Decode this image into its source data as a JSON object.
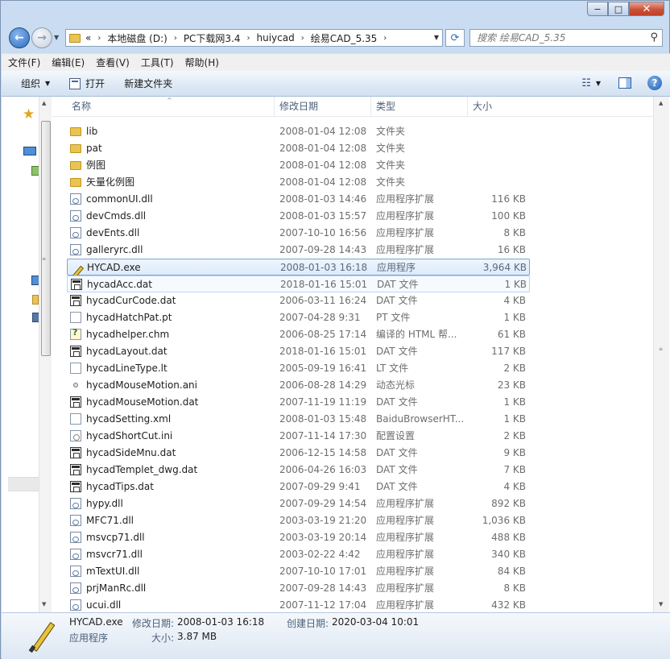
{
  "window": {
    "minimize": "−",
    "maximize": "□",
    "close": "✕"
  },
  "address": {
    "overflow": "«",
    "crumbs": [
      "本地磁盘 (D:)",
      "PC下载网3.4",
      "huiycad",
      "绘易CAD_5.35"
    ]
  },
  "search": {
    "placeholder": "搜索 绘易CAD_5.35"
  },
  "menu": [
    "文件(F)",
    "编辑(E)",
    "查看(V)",
    "工具(T)",
    "帮助(H)"
  ],
  "toolbar": {
    "organize": "组织",
    "open": "打开",
    "new_folder": "新建文件夹"
  },
  "columns": {
    "name": "名称",
    "date": "修改日期",
    "type": "类型",
    "size": "大小"
  },
  "files": [
    {
      "name": "lib",
      "date": "2008-01-04 12:08",
      "type": "文件夹",
      "size": "",
      "icon": "folder"
    },
    {
      "name": "pat",
      "date": "2008-01-04 12:08",
      "type": "文件夹",
      "size": "",
      "icon": "folder"
    },
    {
      "name": "例图",
      "date": "2008-01-04 12:08",
      "type": "文件夹",
      "size": "",
      "icon": "folder"
    },
    {
      "name": "矢量化例图",
      "date": "2008-01-04 12:08",
      "type": "文件夹",
      "size": "",
      "icon": "folder"
    },
    {
      "name": "commonUI.dll",
      "date": "2008-01-03 14:46",
      "type": "应用程序扩展",
      "size": "116 KB",
      "icon": "dll"
    },
    {
      "name": "devCmds.dll",
      "date": "2008-01-03 15:57",
      "type": "应用程序扩展",
      "size": "100 KB",
      "icon": "dll"
    },
    {
      "name": "devEnts.dll",
      "date": "2007-10-10 16:56",
      "type": "应用程序扩展",
      "size": "8 KB",
      "icon": "dll"
    },
    {
      "name": "galleryrc.dll",
      "date": "2007-09-28 14:43",
      "type": "应用程序扩展",
      "size": "16 KB",
      "icon": "dll"
    },
    {
      "name": "HYCAD.exe",
      "date": "2008-01-03 16:18",
      "type": "应用程序",
      "size": "3,964 KB",
      "icon": "exe",
      "state": "selected"
    },
    {
      "name": "hycadAcc.dat",
      "date": "2018-01-16 15:01",
      "type": "DAT 文件",
      "size": "1 KB",
      "icon": "dat",
      "state": "hover"
    },
    {
      "name": "hycadCurCode.dat",
      "date": "2006-03-11 16:24",
      "type": "DAT 文件",
      "size": "4 KB",
      "icon": "dat"
    },
    {
      "name": "hycadHatchPat.pt",
      "date": "2007-04-28 9:31",
      "type": "PT 文件",
      "size": "1 KB",
      "icon": "plain"
    },
    {
      "name": "hycadhelper.chm",
      "date": "2006-08-25 17:14",
      "type": "编译的 HTML 帮...",
      "size": "61 KB",
      "icon": "chm"
    },
    {
      "name": "hycadLayout.dat",
      "date": "2018-01-16 15:01",
      "type": "DAT 文件",
      "size": "117 KB",
      "icon": "dat"
    },
    {
      "name": "hycadLineType.lt",
      "date": "2005-09-19 16:41",
      "type": "LT 文件",
      "size": "2 KB",
      "icon": "plain"
    },
    {
      "name": "hycadMouseMotion.ani",
      "date": "2006-08-28 14:29",
      "type": "动态光标",
      "size": "23 KB",
      "icon": "ani"
    },
    {
      "name": "hycadMouseMotion.dat",
      "date": "2007-11-19 11:19",
      "type": "DAT 文件",
      "size": "1 KB",
      "icon": "dat"
    },
    {
      "name": "hycadSetting.xml",
      "date": "2008-01-03 15:48",
      "type": "BaiduBrowserHT...",
      "size": "1 KB",
      "icon": "plain"
    },
    {
      "name": "hycadShortCut.ini",
      "date": "2007-11-14 17:30",
      "type": "配置设置",
      "size": "2 KB",
      "icon": "ini"
    },
    {
      "name": "hycadSideMnu.dat",
      "date": "2006-12-15 14:58",
      "type": "DAT 文件",
      "size": "9 KB",
      "icon": "dat"
    },
    {
      "name": "hycadTemplet_dwg.dat",
      "date": "2006-04-26 16:03",
      "type": "DAT 文件",
      "size": "7 KB",
      "icon": "dat"
    },
    {
      "name": "hycadTips.dat",
      "date": "2007-09-29 9:41",
      "type": "DAT 文件",
      "size": "4 KB",
      "icon": "dat"
    },
    {
      "name": "hypy.dll",
      "date": "2007-09-29 14:54",
      "type": "应用程序扩展",
      "size": "892 KB",
      "icon": "dll"
    },
    {
      "name": "MFC71.dll",
      "date": "2003-03-19 21:20",
      "type": "应用程序扩展",
      "size": "1,036 KB",
      "icon": "dll"
    },
    {
      "name": "msvcp71.dll",
      "date": "2003-03-19 20:14",
      "type": "应用程序扩展",
      "size": "488 KB",
      "icon": "dll"
    },
    {
      "name": "msvcr71.dll",
      "date": "2003-02-22 4:42",
      "type": "应用程序扩展",
      "size": "340 KB",
      "icon": "dll"
    },
    {
      "name": "mTextUI.dll",
      "date": "2007-10-10 17:01",
      "type": "应用程序扩展",
      "size": "84 KB",
      "icon": "dll"
    },
    {
      "name": "prjManRc.dll",
      "date": "2007-09-28 14:43",
      "type": "应用程序扩展",
      "size": "8 KB",
      "icon": "dll"
    },
    {
      "name": "ucui.dll",
      "date": "2007-11-12 17:04",
      "type": "应用程序扩展",
      "size": "432 KB",
      "icon": "dll"
    }
  ],
  "details": {
    "name": "HYCAD.exe",
    "modified_label": "修改日期:",
    "modified": "2008-01-03 16:18",
    "created_label": "创建日期:",
    "created": "2020-03-04 10:01",
    "type": "应用程序",
    "size_label": "大小:",
    "size": "3.87 MB"
  }
}
